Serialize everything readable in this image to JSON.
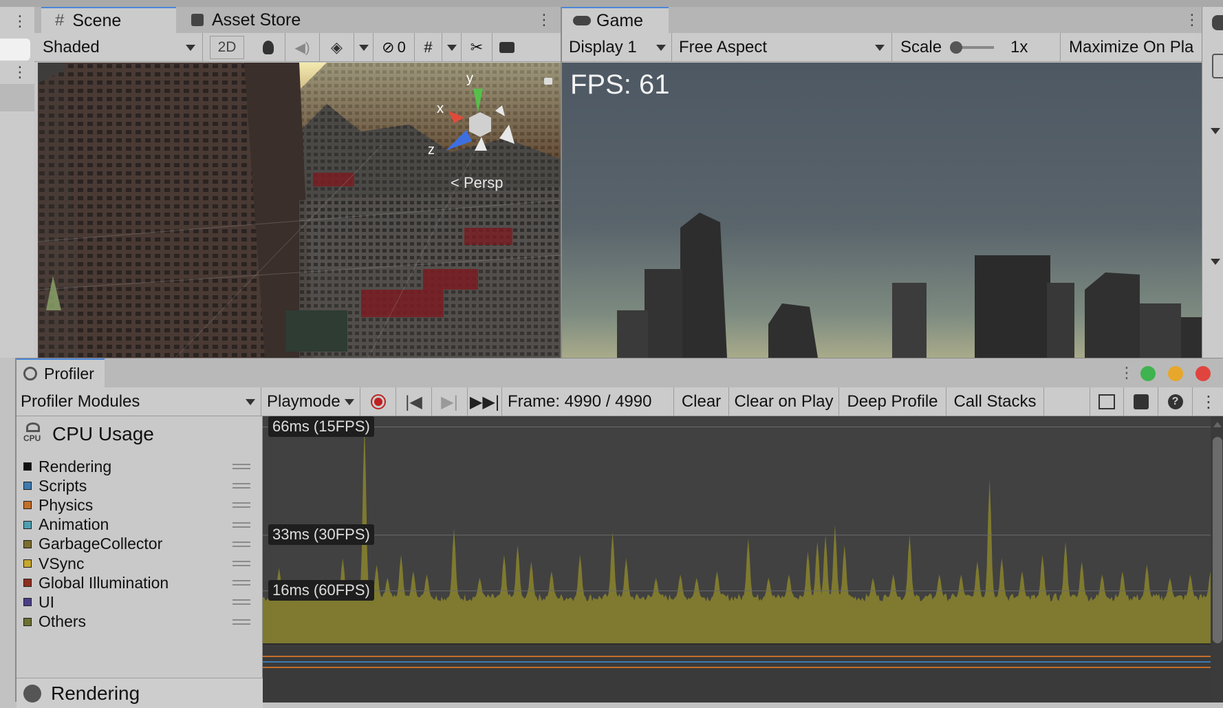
{
  "scene_panel": {
    "tabs": [
      {
        "label": "Scene",
        "icon": "hash-icon"
      },
      {
        "label": "Asset Store",
        "icon": "bag-icon"
      }
    ],
    "toolbar": {
      "shading_mode": "Shaded",
      "mode_2d": "2D",
      "hidden_count": "0"
    },
    "gizmo": {
      "x": "x",
      "y": "y",
      "z": "z",
      "projection": "Persp"
    }
  },
  "game_panel": {
    "tab": {
      "label": "Game",
      "icon": "gamepad-icon"
    },
    "toolbar": {
      "display": "Display 1",
      "aspect": "Free Aspect",
      "scale_label": "Scale",
      "scale_value": "1x",
      "maximize": "Maximize On Pla"
    },
    "fps_readout": "FPS: 61"
  },
  "profiler": {
    "tab": {
      "label": "Profiler",
      "icon": "profiler-icon"
    },
    "toolbar": {
      "modules": "Profiler Modules",
      "target": "Playmode",
      "frame": "Frame: 4990 / 4990",
      "clear": "Clear",
      "clear_on_play": "Clear on Play",
      "deep_profile": "Deep Profile",
      "call_stacks": "Call Stacks"
    },
    "cpu_module": {
      "title": "CPU Usage",
      "cpu_badge": "CPU",
      "legend": [
        {
          "label": "Rendering",
          "color": "#111111"
        },
        {
          "label": "Scripts",
          "color": "#3d7ab0"
        },
        {
          "label": "Physics",
          "color": "#c46f2a"
        },
        {
          "label": "Animation",
          "color": "#4e9fb0"
        },
        {
          "label": "GarbageCollector",
          "color": "#7a6d2e"
        },
        {
          "label": "VSync",
          "color": "#c7a82d"
        },
        {
          "label": "Global Illumination",
          "color": "#8e2e1f"
        },
        {
          "label": "UI",
          "color": "#4a3f86"
        },
        {
          "label": "Others",
          "color": "#6c7033"
        }
      ]
    },
    "rendering_module": {
      "title": "Rendering"
    },
    "window_colors": {
      "green": "#3fb34f",
      "yellow": "#e6a72a",
      "red": "#e0443e"
    }
  },
  "chart_data": {
    "type": "area",
    "title": "CPU Usage",
    "unit": "ms",
    "gridlines": [
      {
        "value": 66,
        "label": "66ms (15FPS)"
      },
      {
        "value": 33,
        "label": "33ms (30FPS)"
      },
      {
        "value": 16,
        "label": "16ms (60FPS)"
      }
    ],
    "ylim": [
      0,
      68
    ],
    "baseline_ms": 14,
    "series": [
      {
        "name": "VSync",
        "color": "#7f7a2f"
      }
    ],
    "spikes": [
      {
        "x": 0.02,
        "value": 23
      },
      {
        "x": 0.1,
        "value": 26
      },
      {
        "x": 0.127,
        "value": 67
      },
      {
        "x": 0.142,
        "value": 24
      },
      {
        "x": 0.155,
        "value": 20
      },
      {
        "x": 0.172,
        "value": 27
      },
      {
        "x": 0.188,
        "value": 22
      },
      {
        "x": 0.205,
        "value": 21
      },
      {
        "x": 0.238,
        "value": 35
      },
      {
        "x": 0.27,
        "value": 20
      },
      {
        "x": 0.3,
        "value": 27
      },
      {
        "x": 0.318,
        "value": 30
      },
      {
        "x": 0.335,
        "value": 25
      },
      {
        "x": 0.36,
        "value": 22
      },
      {
        "x": 0.395,
        "value": 27
      },
      {
        "x": 0.435,
        "value": 34
      },
      {
        "x": 0.452,
        "value": 26
      },
      {
        "x": 0.49,
        "value": 20
      },
      {
        "x": 0.52,
        "value": 21
      },
      {
        "x": 0.541,
        "value": 20
      },
      {
        "x": 0.565,
        "value": 22
      },
      {
        "x": 0.605,
        "value": 32
      },
      {
        "x": 0.63,
        "value": 20
      },
      {
        "x": 0.655,
        "value": 21
      },
      {
        "x": 0.678,
        "value": 28
      },
      {
        "x": 0.69,
        "value": 31
      },
      {
        "x": 0.7,
        "value": 33
      },
      {
        "x": 0.712,
        "value": 36
      },
      {
        "x": 0.725,
        "value": 30
      },
      {
        "x": 0.76,
        "value": 20
      },
      {
        "x": 0.785,
        "value": 21
      },
      {
        "x": 0.805,
        "value": 33
      },
      {
        "x": 0.842,
        "value": 21
      },
      {
        "x": 0.87,
        "value": 21
      },
      {
        "x": 0.89,
        "value": 25
      },
      {
        "x": 0.905,
        "value": 50
      },
      {
        "x": 0.92,
        "value": 26
      },
      {
        "x": 0.945,
        "value": 22
      },
      {
        "x": 0.97,
        "value": 27
      },
      {
        "x": 1.0,
        "value": 31
      },
      {
        "x": 1.02,
        "value": 25
      },
      {
        "x": 1.045,
        "value": 21
      },
      {
        "x": 1.07,
        "value": 22
      },
      {
        "x": 1.1,
        "value": 24
      },
      {
        "x": 1.13,
        "value": 20
      },
      {
        "x": 1.155,
        "value": 21
      },
      {
        "x": 1.18,
        "value": 22
      }
    ]
  }
}
